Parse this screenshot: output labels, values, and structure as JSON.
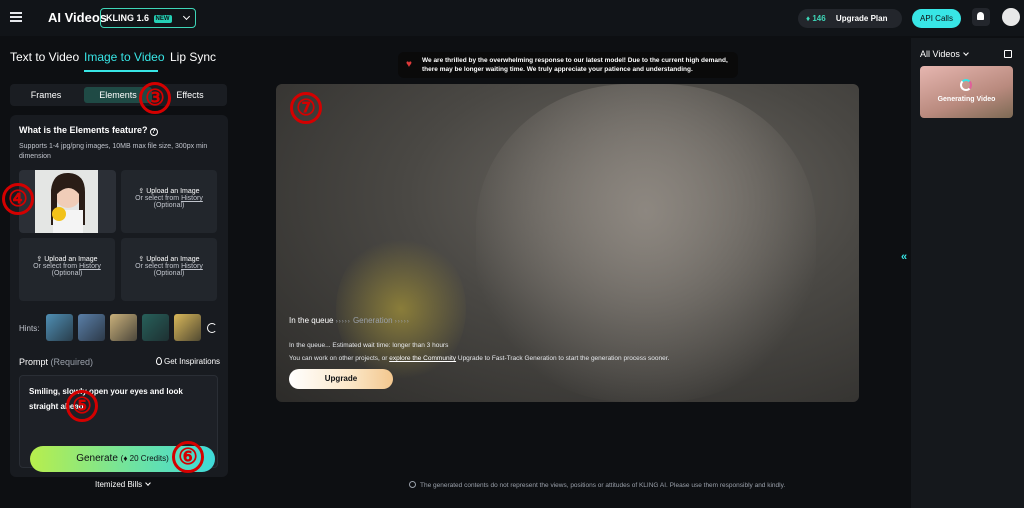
{
  "header": {
    "app_title": "AI Videos",
    "model": "KLING 1.6",
    "model_badge": "NEW",
    "credits": "146",
    "upgrade_plan": "Upgrade Plan",
    "api_calls": "API Calls"
  },
  "mode_tabs": [
    "Text to Video",
    "Image to Video",
    "Lip Sync"
  ],
  "active_mode": "Image to Video",
  "sub_tabs": [
    "Frames",
    "Elements",
    "Effects"
  ],
  "active_sub_tab": "Elements",
  "elements_panel": {
    "question": "What is the Elements feature?",
    "support_text": "Supports 1-4 jpg/png images, 10MB max file size, 300px min dimension",
    "slots": [
      {
        "upload": "Upload an Image",
        "history_prefix": "Or select from",
        "history_link": "History",
        "optional": "(Optional)"
      },
      {
        "upload": "Upload an Image",
        "history_prefix": "Or select from",
        "history_link": "History",
        "optional": "(Optional)"
      },
      {
        "upload": "Upload an Image",
        "history_prefix": "Or select from",
        "history_link": "History",
        "optional": "(Optional)"
      }
    ],
    "hints_label": "Hints:",
    "hint_colors": [
      "#4f8fb4",
      "#5a7fa8",
      "#c9b07a",
      "#27605a",
      "#d9b85a"
    ]
  },
  "prompt": {
    "label": "Prompt",
    "required": "(Required)",
    "inspirations": "Get Inspirations",
    "text": "Smiling, slowly open your eyes and look straight ahead."
  },
  "generate": {
    "label": "Generate",
    "credits": "20 Credits",
    "itemized": "Itemized Bills"
  },
  "notice": "We are thrilled by the overwhelming response to our latest model! Due to the current high demand, there may be longer waiting time. We truly appreciate your patience and understanding.",
  "queue": {
    "status": "In the queue",
    "next": "Generation",
    "line1": "In the queue... Estimated wait time: longer than 3 hours",
    "line2_prefix": "You can work on other projects, or",
    "line2_link": "explore the Community",
    "line2_suffix": "Upgrade to Fast-Track Generation to start the generation process sooner.",
    "upgrade": "Upgrade"
  },
  "disclaimer": "The generated contents do not represent the views, positions or attitudes of KLING AI. Please use them responsibly and kindly.",
  "right_panel": {
    "all_videos": "All Videos",
    "generating": "Generating Video"
  },
  "markers": [
    "③",
    "④",
    "⑤",
    "⑥",
    "⑦"
  ]
}
